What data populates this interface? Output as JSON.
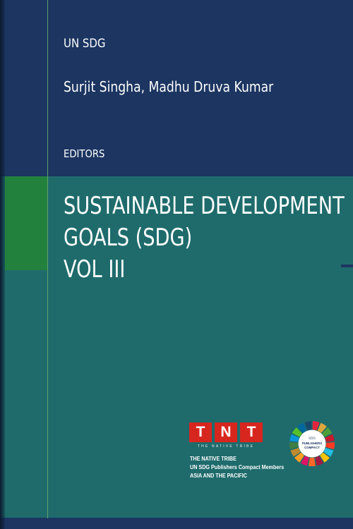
{
  "cover": {
    "series_label": "UN SDG",
    "authors": "Surjit Singha, Madhu Druva Kumar",
    "role_label": "EDITORS",
    "title_lines": [
      "SUSTAINABLE DEVELOPMENT",
      "GOALS (SDG)",
      "VOL III"
    ]
  },
  "publisher": {
    "logo_letters": [
      "T",
      "N",
      "T"
    ],
    "logo_tagline": "THE NATIVE TRIBE",
    "lines": [
      "THE NATIVE TRIBE",
      "UN SDG Publishers Compact Members",
      "ASIA AND THE PACIFIC"
    ]
  },
  "sdg_badge": {
    "line1": "SDG",
    "line2": "PUBLISHERS",
    "line3": "COMPACT"
  },
  "colors": {
    "navy": "#1c3561",
    "teal": "#1f6b6c",
    "green": "#23813e",
    "logo_red": "#d7261e"
  }
}
